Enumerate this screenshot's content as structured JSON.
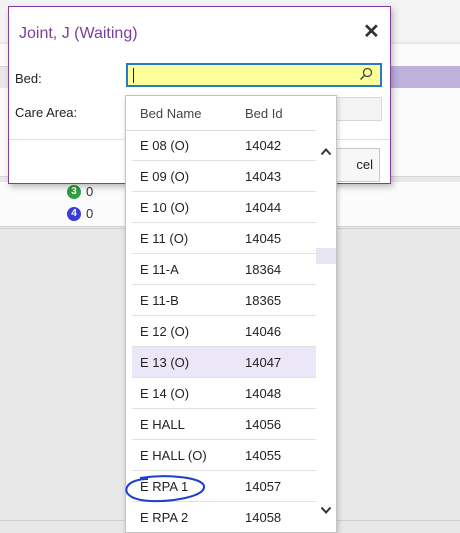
{
  "dialog": {
    "title": "Joint, J (Waiting)",
    "bed_label": "Bed:",
    "care_area_label": "Care Area:",
    "bed_value": "",
    "cancel_label": "cel"
  },
  "dropdown": {
    "headers": [
      "Bed Name",
      "Bed Id"
    ],
    "rows": [
      {
        "name": "E 08 (O)",
        "id": "14042"
      },
      {
        "name": "E 09 (O)",
        "id": "14043"
      },
      {
        "name": "E 10 (O)",
        "id": "14044"
      },
      {
        "name": "E 11 (O)",
        "id": "14045"
      },
      {
        "name": "E 11-A",
        "id": "18364"
      },
      {
        "name": "E 11-B",
        "id": "18365"
      },
      {
        "name": "E 12 (O)",
        "id": "14046"
      },
      {
        "name": "E 13 (O)",
        "id": "14047"
      },
      {
        "name": "E 14 (O)",
        "id": "14048"
      },
      {
        "name": "E HALL",
        "id": "14056"
      },
      {
        "name": "E HALL (O)",
        "id": "14055"
      },
      {
        "name": "E RPA 1",
        "id": "14057"
      },
      {
        "name": "E RPA 2",
        "id": "14058"
      }
    ],
    "selected_index": 7,
    "annotated_index": 11
  },
  "background": {
    "badges": [
      {
        "num": "3",
        "text": "0",
        "color": "#2e9e3e"
      },
      {
        "num": "4",
        "text": "0",
        "color": "#3b3bd6"
      }
    ]
  },
  "colors": {
    "accent": "#7b3f9a",
    "input_highlight": "#ffff99",
    "focus_border": "#2a78c8",
    "annotation": "#1e3fcf"
  }
}
